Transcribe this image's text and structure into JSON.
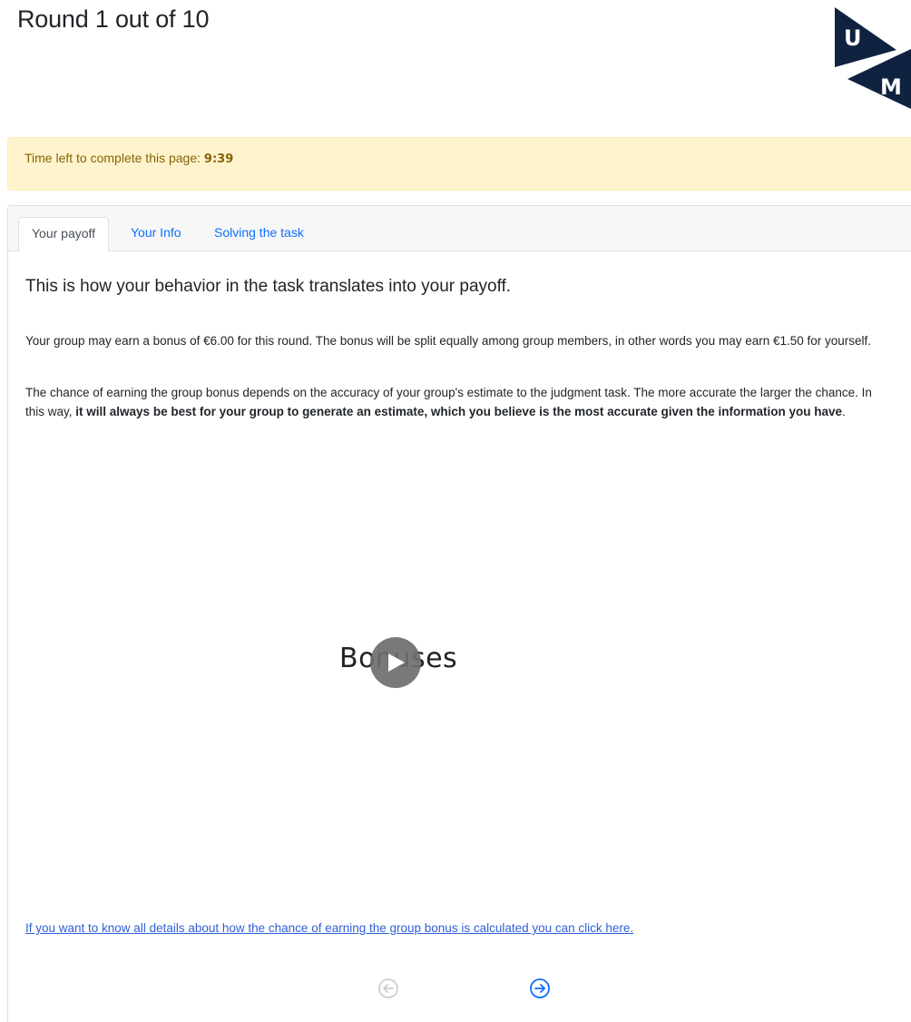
{
  "header": {
    "title": "Round 1 out of 10",
    "logo": {
      "letters": [
        "U",
        "M"
      ],
      "color": "#0f2240"
    }
  },
  "timer": {
    "label": "Time left to complete this page:",
    "value": "9:39"
  },
  "tabs": [
    {
      "label": "Your payoff",
      "active": true
    },
    {
      "label": "Your Info",
      "active": false
    },
    {
      "label": "Solving the task",
      "active": false
    }
  ],
  "content": {
    "heading": "This is how your behavior in the task translates into your payoff.",
    "paragraph1": "Your group may earn a bonus of €6.00 for this round. The bonus will be split equally among group members, in other words you may earn €1.50 for yourself.",
    "paragraph2_prefix": "The chance of earning the group bonus depends on the accuracy of your group's estimate to the judgment task. The more accurate the larger the chance. In this way,",
    "paragraph2_bold": "it will always be best for your group to generate an estimate, which you believe is the most accurate given the information you have",
    "paragraph2_suffix": ".",
    "video": {
      "title": "Bonuses",
      "play_icon": "play-icon"
    },
    "details_link": "If you want to know all details about how the chance of earning the group bonus is calculated you can click here."
  },
  "navigation": {
    "back_icon": "arrow-left-circle-icon",
    "next_icon": "arrow-right-circle-icon",
    "back_color": "#c9c9c9",
    "next_color": "#0d6efd"
  }
}
